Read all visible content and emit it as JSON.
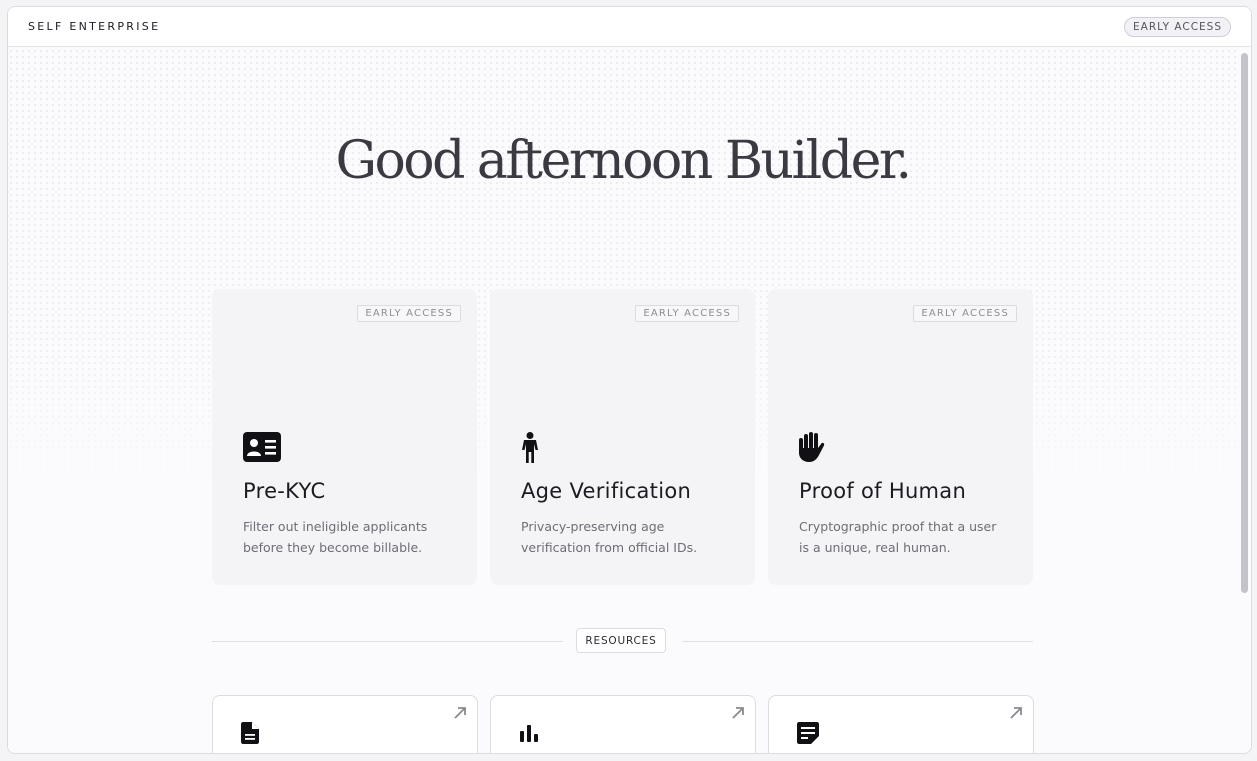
{
  "header": {
    "brand": "SELF ENTERPRISE",
    "badge": "EARLY ACCESS"
  },
  "greeting": "Good afternoon Builder.",
  "products": [
    {
      "badge": "EARLY ACCESS",
      "icon": "id-card-icon",
      "title": "Pre-KYC",
      "description": "Filter out ineligible applicants before they become billable."
    },
    {
      "badge": "EARLY ACCESS",
      "icon": "person-icon",
      "title": "Age Verification",
      "description": "Privacy-preserving age verification from official IDs."
    },
    {
      "badge": "EARLY ACCESS",
      "icon": "hand-icon",
      "title": "Proof of Human",
      "description": "Cryptographic proof that a user is a unique, real human."
    }
  ],
  "resources": {
    "label": "RESOURCES",
    "items": [
      {
        "icon": "document-icon"
      },
      {
        "icon": "bar-chart-icon"
      },
      {
        "icon": "note-icon"
      }
    ]
  },
  "colors": {
    "background": "#fbfafc",
    "card": "#f4f3f6",
    "text": "#1c1b22",
    "muted": "#6e6d75"
  }
}
